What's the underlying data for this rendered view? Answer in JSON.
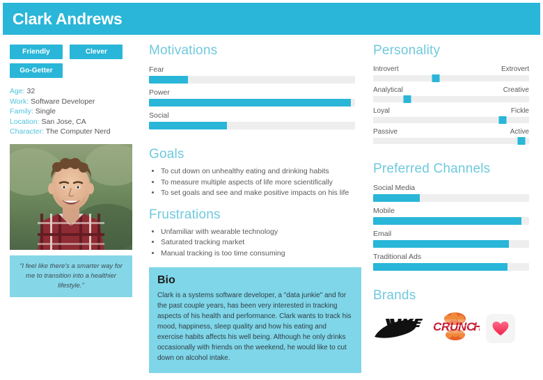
{
  "header": {
    "title": "Clark Andrews"
  },
  "colors": {
    "brand_teal": "#29b6d8",
    "heading_teal": "#6fc9dd",
    "bio_bg": "#7fd6e8",
    "quote_bg": "#85d7e8",
    "track_gray": "#eeeeee"
  },
  "profile": {
    "tags": [
      "Friendly",
      "Clever",
      "Go-Getter"
    ],
    "attributes": [
      {
        "key": "Age:",
        "value": "32"
      },
      {
        "key": "Work:",
        "value": "Software Developer"
      },
      {
        "key": "Family:",
        "value": "Single"
      },
      {
        "key": "Location:",
        "value": "San Jose, CA"
      },
      {
        "key": "Character:",
        "value": "The Computer Nerd"
      }
    ],
    "photo_alt": "portrait-photo",
    "quote": "\"I feel like there's a smarter way for me to transition into a healthier lifestyle.\""
  },
  "motivations": {
    "heading": "Motivations",
    "items": [
      {
        "label": "Fear",
        "value": 19
      },
      {
        "label": "Power",
        "value": 98
      },
      {
        "label": "Social",
        "value": 38
      }
    ]
  },
  "goals": {
    "heading": "Goals",
    "items": [
      "To cut down on unhealthy eating and drinking habits",
      "To measure multiple aspects of life more scientifically",
      "To set goals and see and make positive impacts on his life"
    ]
  },
  "frustrations": {
    "heading": "Frustrations",
    "items": [
      "Unfamiliar with wearable technology",
      "Saturated tracking market",
      "Manual tracking is too time consuming"
    ]
  },
  "bio": {
    "heading": "Bio",
    "text": "Clark is a systems software developer, a \"data junkie\" and for the past couple years, has been very interested in tracking aspects of his health and performance. Clark wants to track his mood, happiness, sleep quality and how his eating and exercise habits affects his well being. Although he only drinks occasionally with friends on the weekend, he would like to cut down on alcohol intake."
  },
  "personality": {
    "heading": "Personality",
    "items": [
      {
        "left": "Introvert",
        "right": "Extrovert",
        "value": 40
      },
      {
        "left": "Analytical",
        "right": "Creative",
        "value": 22
      },
      {
        "left": "Loyal",
        "right": "Fickle",
        "value": 83
      },
      {
        "left": "Passive",
        "right": "Active",
        "value": 95
      }
    ]
  },
  "channels": {
    "heading": "Preferred Channels",
    "items": [
      {
        "label": "Social Media",
        "value": 30
      },
      {
        "label": "Mobile",
        "value": 95
      },
      {
        "label": "Email",
        "value": 87
      },
      {
        "label": "Traditional Ads",
        "value": 86
      }
    ]
  },
  "brands": {
    "heading": "Brands",
    "items": [
      {
        "name": "NIKE",
        "icon": "nike-logo"
      },
      {
        "name": "CRUNCH",
        "icon": "crunch-logo"
      },
      {
        "name": "Health",
        "icon": "heart-app-icon"
      }
    ]
  }
}
